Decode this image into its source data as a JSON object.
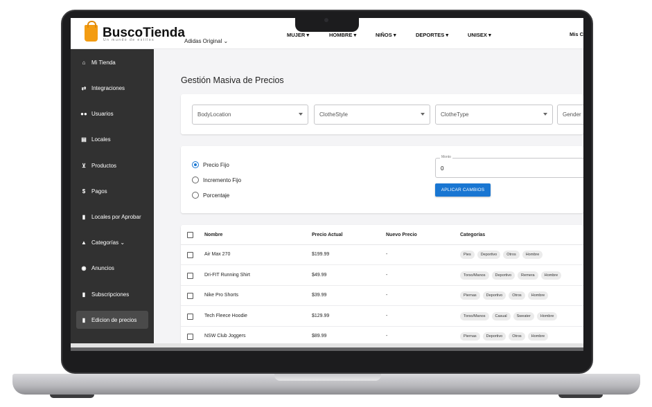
{
  "header": {
    "brand": "BuscoTienda",
    "tagline": "Un mundo de estilos",
    "store_select": "Adidas Original",
    "nav": [
      {
        "label": "MUJER"
      },
      {
        "label": "HOMBRE"
      },
      {
        "label": "NIÑOS"
      },
      {
        "label": "DEPORTES"
      },
      {
        "label": "UNISEX"
      }
    ],
    "account": "Mis C"
  },
  "sidebar": {
    "items": [
      {
        "label": "Mi Tienda",
        "icon": "store-icon"
      },
      {
        "label": "Integraciones",
        "icon": "integration-icon"
      },
      {
        "label": "Usuarios",
        "icon": "users-icon"
      },
      {
        "label": "Locales",
        "icon": "storefront-icon"
      },
      {
        "label": "Productos",
        "icon": "cart-icon"
      },
      {
        "label": "Pagos",
        "icon": "dollar-icon"
      },
      {
        "label": "Locales por Aprobar",
        "icon": "document-icon"
      },
      {
        "label": "Categorías",
        "icon": "category-icon"
      },
      {
        "label": "Anuncios",
        "icon": "megaphone-icon"
      },
      {
        "label": "Subscripciones",
        "icon": "document-icon"
      },
      {
        "label": "Edicion de precios",
        "icon": "document-icon",
        "active": true
      }
    ]
  },
  "main": {
    "title": "Gestión Masiva de Precios",
    "filters": [
      {
        "label": "BodyLocation"
      },
      {
        "label": "ClotheStyle"
      },
      {
        "label": "ClotheType"
      },
      {
        "label": "Gender"
      }
    ],
    "price_mode": {
      "options": [
        "Precio Fijo",
        "Incremento Fijo",
        "Porcentaje"
      ],
      "selected": "Precio Fijo"
    },
    "monto": {
      "label": "Monto",
      "value": "0"
    },
    "apply_label": "APLICAR CAMBIOS"
  },
  "table": {
    "columns": [
      "Nombre",
      "Precio Actual",
      "Nuevo Precio",
      "Categorías"
    ],
    "rows": [
      {
        "name": "Air Max 270",
        "price": "$199.99",
        "new_price": "-",
        "categories": [
          "Pies",
          "Deportivo",
          "Otros",
          "Hombre"
        ]
      },
      {
        "name": "Dri-FIT Running Shirt",
        "price": "$49.99",
        "new_price": "-",
        "categories": [
          "Torso/Manos",
          "Deportivo",
          "Remera",
          "Hombre"
        ]
      },
      {
        "name": "Nike Pro Shorts",
        "price": "$39.99",
        "new_price": "-",
        "categories": [
          "Piernas",
          "Deportivo",
          "Otros",
          "Hombre"
        ]
      },
      {
        "name": "Tech Fleece Hoodie",
        "price": "$129.99",
        "new_price": "-",
        "categories": [
          "Torso/Manos",
          "Casual",
          "Sweater",
          "Hombre"
        ]
      },
      {
        "name": "NSW Club Joggers",
        "price": "$89.99",
        "new_price": "-",
        "categories": [
          "Piernas",
          "Deportivo",
          "Otros",
          "Hombre"
        ]
      }
    ]
  },
  "colors": {
    "accent": "#1976d2",
    "sidebar_bg": "#313131",
    "brand_orange": "#f39c12"
  }
}
